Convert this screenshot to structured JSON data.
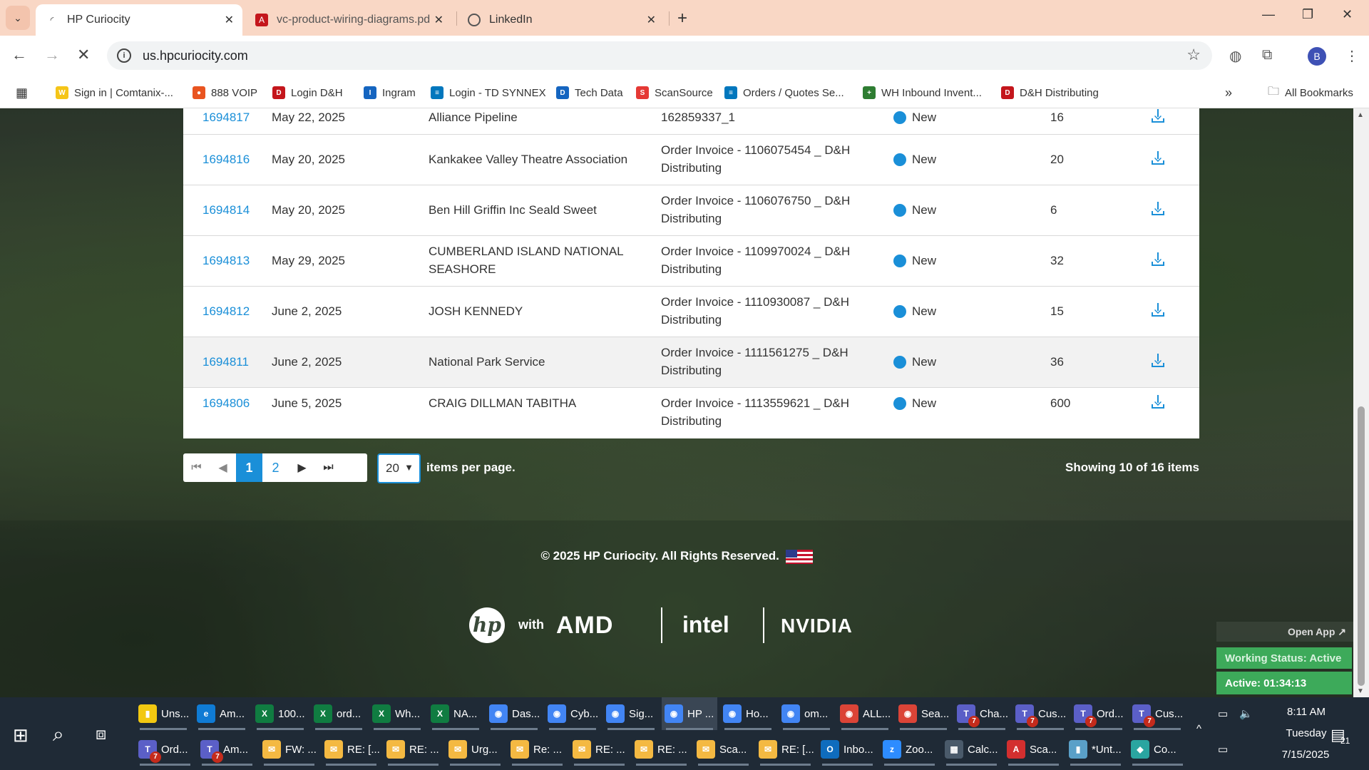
{
  "browser": {
    "tabs": [
      {
        "title": "HP Curiocity",
        "active": true
      },
      {
        "title": "vc-product-wiring-diagrams.pd",
        "active": false
      },
      {
        "title": "LinkedIn",
        "active": false
      }
    ],
    "url": "us.hpcuriocity.com",
    "profile_initial": "B",
    "bookmarks": [
      {
        "label": "Sign in | Comtanix-...",
        "color": "#f5c518"
      },
      {
        "label": "888 VOIP",
        "color": "#e95420"
      },
      {
        "label": "Login D&H",
        "color": "#c4161c"
      },
      {
        "label": "Ingram",
        "color": "#1565c0"
      },
      {
        "label": "Login - TD SYNNEX",
        "color": "#0277bd"
      },
      {
        "label": "Tech Data",
        "color": "#1565c0"
      },
      {
        "label": "ScanSource",
        "color": "#e53935"
      },
      {
        "label": "Orders / Quotes Se...",
        "color": "#0277bd"
      },
      {
        "label": "WH Inbound Invent...",
        "color": "#2e7d32"
      },
      {
        "label": "D&H Distributing",
        "color": "#c4161c"
      }
    ],
    "all_bookmarks_label": "All Bookmarks"
  },
  "orders": {
    "rows": [
      {
        "id": "1694817",
        "date": "May 22, 2025",
        "customer": "Alliance Pipeline",
        "description": "162859337_1",
        "status": "New",
        "qty": "16"
      },
      {
        "id": "1694816",
        "date": "May 20, 2025",
        "customer": "Kankakee Valley Theatre Association",
        "description": "Order Invoice - 1106075454 _ D&H Distributing",
        "status": "New",
        "qty": "20"
      },
      {
        "id": "1694814",
        "date": "May 20, 2025",
        "customer": "Ben Hill Griffin Inc Seald Sweet",
        "description": "Order Invoice - 1106076750 _ D&H Distributing",
        "status": "New",
        "qty": "6"
      },
      {
        "id": "1694813",
        "date": "May 29, 2025",
        "customer": "CUMBERLAND ISLAND NATIONAL SEASHORE",
        "description": "Order Invoice - 1109970024 _ D&H Distributing",
        "status": "New",
        "qty": "32"
      },
      {
        "id": "1694812",
        "date": "June 2, 2025",
        "customer": "JOSH KENNEDY",
        "description": "Order Invoice - 1110930087 _ D&H Distributing",
        "status": "New",
        "qty": "15"
      },
      {
        "id": "1694811",
        "date": "June 2, 2025",
        "customer": "National Park Service",
        "description": "Order Invoice - 1111561275 _ D&H Distributing",
        "status": "New",
        "qty": "36"
      },
      {
        "id": "1694806",
        "date": "June 5, 2025",
        "customer": "CRAIG DILLMAN TABITHA",
        "description": "Order Invoice - 1113559621 _ D&H Distributing",
        "status": "New",
        "qty": "600"
      }
    ],
    "status_color": "#1a8fd8"
  },
  "pagination": {
    "pages": [
      "1",
      "2"
    ],
    "current_page": "1",
    "per_page": "20",
    "per_page_label": "items per page.",
    "showing": "Showing 10 of 16 items"
  },
  "footer": {
    "copyright": "© 2025 HP Curiocity. All Rights Reserved.",
    "with_label": "with",
    "partners": [
      "hp",
      "AMD",
      "intel",
      "NVIDIA"
    ]
  },
  "widget": {
    "open_app": "Open App ↗",
    "working_status": "Working Status: Active",
    "active_timer": "Active: 01:34:13"
  },
  "taskbar": {
    "row1": [
      {
        "label": "Uns...",
        "icon": "note",
        "color": "#f2c811"
      },
      {
        "label": "Am...",
        "icon": "edge",
        "color": "#0f7bd4"
      },
      {
        "label": "100...",
        "icon": "X",
        "color": "#107c41"
      },
      {
        "label": "ord...",
        "icon": "X",
        "color": "#107c41"
      },
      {
        "label": "Wh...",
        "icon": "X",
        "color": "#107c41"
      },
      {
        "label": "NA...",
        "icon": "X",
        "color": "#107c41"
      },
      {
        "label": "Das...",
        "icon": "chrome",
        "color": "#4285f4"
      },
      {
        "label": "Cyb...",
        "icon": "chrome",
        "color": "#4285f4"
      },
      {
        "label": "Sig...",
        "icon": "chrome",
        "color": "#4285f4"
      },
      {
        "label": "HP ...",
        "icon": "chrome",
        "color": "#4285f4"
      },
      {
        "label": "Ho...",
        "icon": "chrome",
        "color": "#4285f4"
      },
      {
        "label": "om...",
        "icon": "chrome",
        "color": "#4285f4"
      },
      {
        "label": "ALL...",
        "icon": "chrome",
        "color": "#db4437"
      },
      {
        "label": "Sea...",
        "icon": "chrome",
        "color": "#db4437"
      },
      {
        "label": "Cha...",
        "icon": "T",
        "color": "#5b5fc7"
      },
      {
        "label": "Cus...",
        "icon": "T",
        "color": "#5b5fc7"
      },
      {
        "label": "Ord...",
        "icon": "T",
        "color": "#5b5fc7"
      },
      {
        "label": "Cus...",
        "icon": "T",
        "color": "#5b5fc7"
      }
    ],
    "row2": [
      {
        "label": "Ord...",
        "icon": "T",
        "color": "#5b5fc7"
      },
      {
        "label": "Am...",
        "icon": "T",
        "color": "#5b5fc7"
      },
      {
        "label": "FW: ...",
        "icon": "mail",
        "color": "#f4b942"
      },
      {
        "label": "RE: [...",
        "icon": "mail",
        "color": "#f4b942"
      },
      {
        "label": "RE: ...",
        "icon": "mail",
        "color": "#f4b942"
      },
      {
        "label": "Urg...",
        "icon": "mail",
        "color": "#f4b942"
      },
      {
        "label": "Re: ...",
        "icon": "mail",
        "color": "#f4b942"
      },
      {
        "label": "RE: ...",
        "icon": "mail",
        "color": "#f4b942"
      },
      {
        "label": "RE: ...",
        "icon": "mail",
        "color": "#f4b942"
      },
      {
        "label": "Sca...",
        "icon": "mail",
        "color": "#f4b942"
      },
      {
        "label": "RE: [...",
        "icon": "mail",
        "color": "#f4b942"
      },
      {
        "label": "Inbo...",
        "icon": "O",
        "color": "#0f6cbd"
      },
      {
        "label": "Zoo...",
        "icon": "zoom",
        "color": "#2d8cff"
      },
      {
        "label": "Calc...",
        "icon": "calc",
        "color": "#4a5a6a"
      },
      {
        "label": "Sca...",
        "icon": "pdf",
        "color": "#d32f2f"
      },
      {
        "label": "*Unt...",
        "icon": "note",
        "color": "#5aa0c8"
      },
      {
        "label": "Co...",
        "icon": "app",
        "color": "#2aa5a0"
      }
    ],
    "badge_count": "7",
    "clock": {
      "time": "8:11 AM",
      "day": "Tuesday",
      "date": "7/15/2025"
    },
    "notifications": "21"
  }
}
